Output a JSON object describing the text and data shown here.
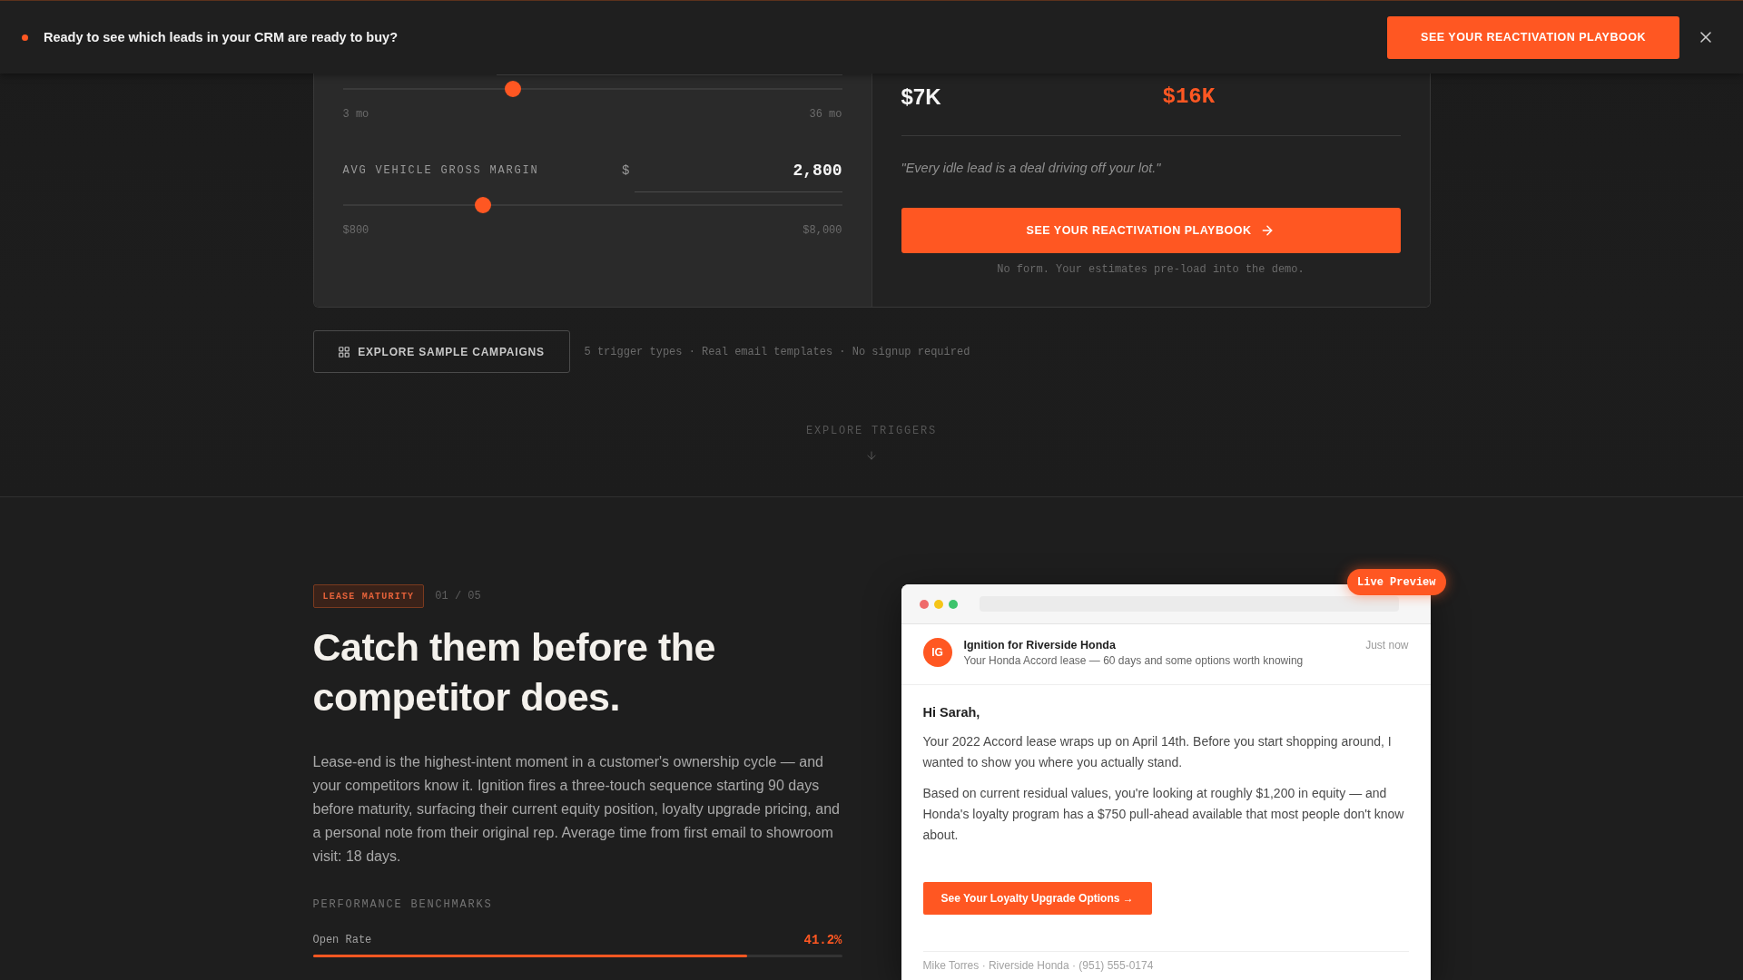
{
  "announcement_bar": {
    "message": "Ready to see which leads in your CRM are ready to buy?",
    "cta": "SEE YOUR REACTIVATION PLAYBOOK"
  },
  "calculator": {
    "sliders": [
      {
        "level": 0.34,
        "min_label": "3 mo",
        "max_label": "36 mo"
      },
      {
        "label": "AVG VEHICLE GROSS MARGIN",
        "prefix": "$",
        "value": "2,800",
        "level": 0.28,
        "min_label": "$800",
        "max_label": "$8,000"
      }
    ],
    "results": [
      {
        "value": "$7K",
        "highlighted": false
      },
      {
        "value": "$16K",
        "highlighted": true
      }
    ],
    "quote": "\"Every idle lead is a deal driving off your lot.\"",
    "cta": "SEE YOUR REACTIVATION PLAYBOOK",
    "note": "No form. Your estimates pre-load into the demo."
  },
  "explore": {
    "button": "EXPLORE SAMPLE CAMPAIGNS",
    "caption": "5 trigger types · Real email templates · No signup required"
  },
  "scroll_hint": "EXPLORE TRIGGERS",
  "trigger": {
    "tag": "LEASE MATURITY",
    "counter": "01 / 05",
    "heading": "Catch them before the competitor does.",
    "description": "Lease-end is the highest-intent moment in a customer's ownership cycle — and your competitors know it. Ignition fires a three-touch sequence starting 90 days before maturity, surfacing their current equity position, loyalty upgrade pricing, and a personal note from their original rep. Average time from first email to showroom visit: 18 days.",
    "benchmarks_title": "PERFORMANCE BENCHMARKS",
    "benchmarks": [
      {
        "label": "Open Rate",
        "value": "41.2%",
        "level": 0.82
      }
    ]
  },
  "preview": {
    "badge": "Live Preview",
    "avatar": "IG",
    "sender": "Ignition for Riverside Honda",
    "subject": "Your Honda Accord lease — 60 days and some options worth knowing",
    "time": "Just now",
    "greeting": "Hi Sarah,",
    "paragraphs": [
      "Your 2022 Accord lease wraps up on April 14th. Before you start shopping around, I wanted to show you where you actually stand.",
      "Based on current residual values, you're looking at roughly $1,200 in equity — and Honda's loyalty program has a $750 pull-ahead available that most people don't know about."
    ],
    "cta": "See Your Loyalty Upgrade Options →",
    "signature": "Mike Torres · Riverside Honda · (951) 555-0174"
  }
}
